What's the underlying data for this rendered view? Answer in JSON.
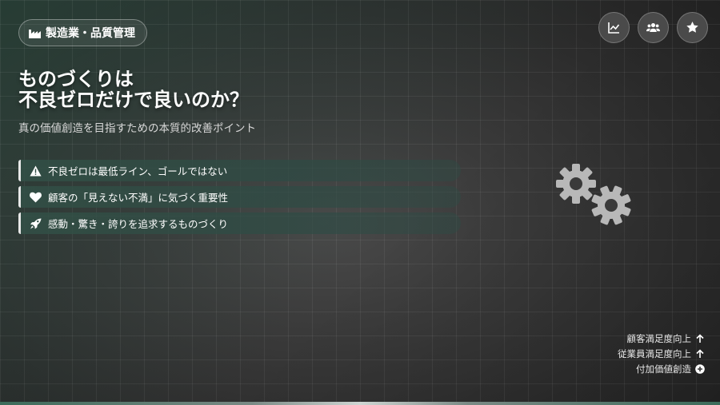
{
  "badge": {
    "icon": "factory-icon",
    "label": "製造業・品質管理"
  },
  "top_icons": [
    "chart-line-icon",
    "users-icon",
    "star-icon"
  ],
  "title": {
    "line1": "ものづくりは",
    "line2": "不良ゼロだけで良いのか？"
  },
  "subtitle": "真の価値創造を目指すための本質的改善ポイント",
  "points": [
    {
      "icon": "warning-icon",
      "label": "不良ゼロは最低ライン、ゴールではない"
    },
    {
      "icon": "heart-icon",
      "label": "顧客の「見えない不満」に気づく重要性"
    },
    {
      "icon": "rocket-icon",
      "label": "感動・驚き・誇りを追求するものづくり"
    }
  ],
  "stats": [
    {
      "label": "顧客満足度向上",
      "icon": "arrow-up-icon"
    },
    {
      "label": "従業員満足度向上",
      "icon": "arrow-up-icon"
    },
    {
      "label": "付加価値創造",
      "icon": "plus-circle-icon"
    }
  ],
  "colors": {
    "accent_green": "#3c6b5a",
    "gear_gray": "#b8b8b8"
  }
}
